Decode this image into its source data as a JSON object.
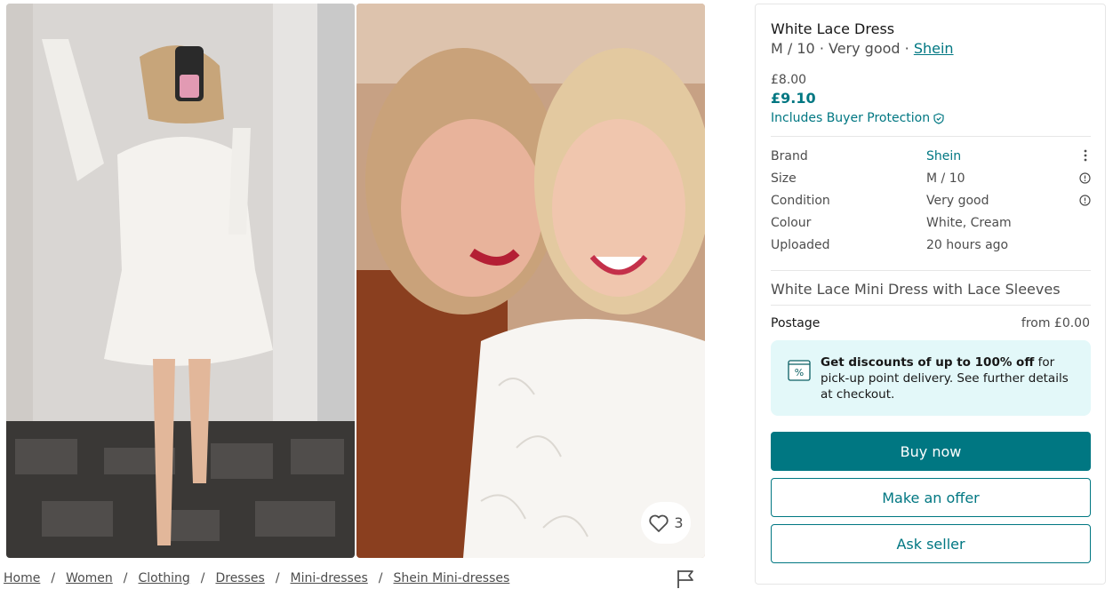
{
  "gallery": {
    "favourites_count": "3",
    "photos": [
      {
        "alt": "photo-1"
      },
      {
        "alt": "photo-2"
      }
    ]
  },
  "breadcrumb": [
    "Home",
    "Women",
    "Clothing",
    "Dresses",
    "Mini-dresses",
    "Shein Mini-dresses"
  ],
  "breadcrumb_separator": "/",
  "item": {
    "title": "White Lace Dress",
    "subtitle_prefix": "M / 10 · Very good · ",
    "brand_link": "Shein",
    "price_original": "£8.00",
    "price_total": "£9.10",
    "buyer_protection": "Includes Buyer Protection",
    "details": [
      {
        "label": "Brand",
        "value": "Shein"
      },
      {
        "label": "Size",
        "value": "M / 10"
      },
      {
        "label": "Condition",
        "value": "Very good"
      },
      {
        "label": "Colour",
        "value": "White, Cream"
      },
      {
        "label": "Uploaded",
        "value": "20 hours ago"
      }
    ],
    "description": "White Lace Mini Dress with Lace Sleeves",
    "postage_label": "Postage",
    "postage_value": "from £0.00"
  },
  "promo": {
    "bold": "Get discounts of up to 100% off",
    "rest": " for pick-up point delivery. See further details at checkout."
  },
  "actions": {
    "buy_now": "Buy now",
    "make_offer": "Make an offer",
    "ask_seller": "Ask seller"
  },
  "colors": {
    "accent": "#007782",
    "promo_bg": "#e3f8f9"
  }
}
